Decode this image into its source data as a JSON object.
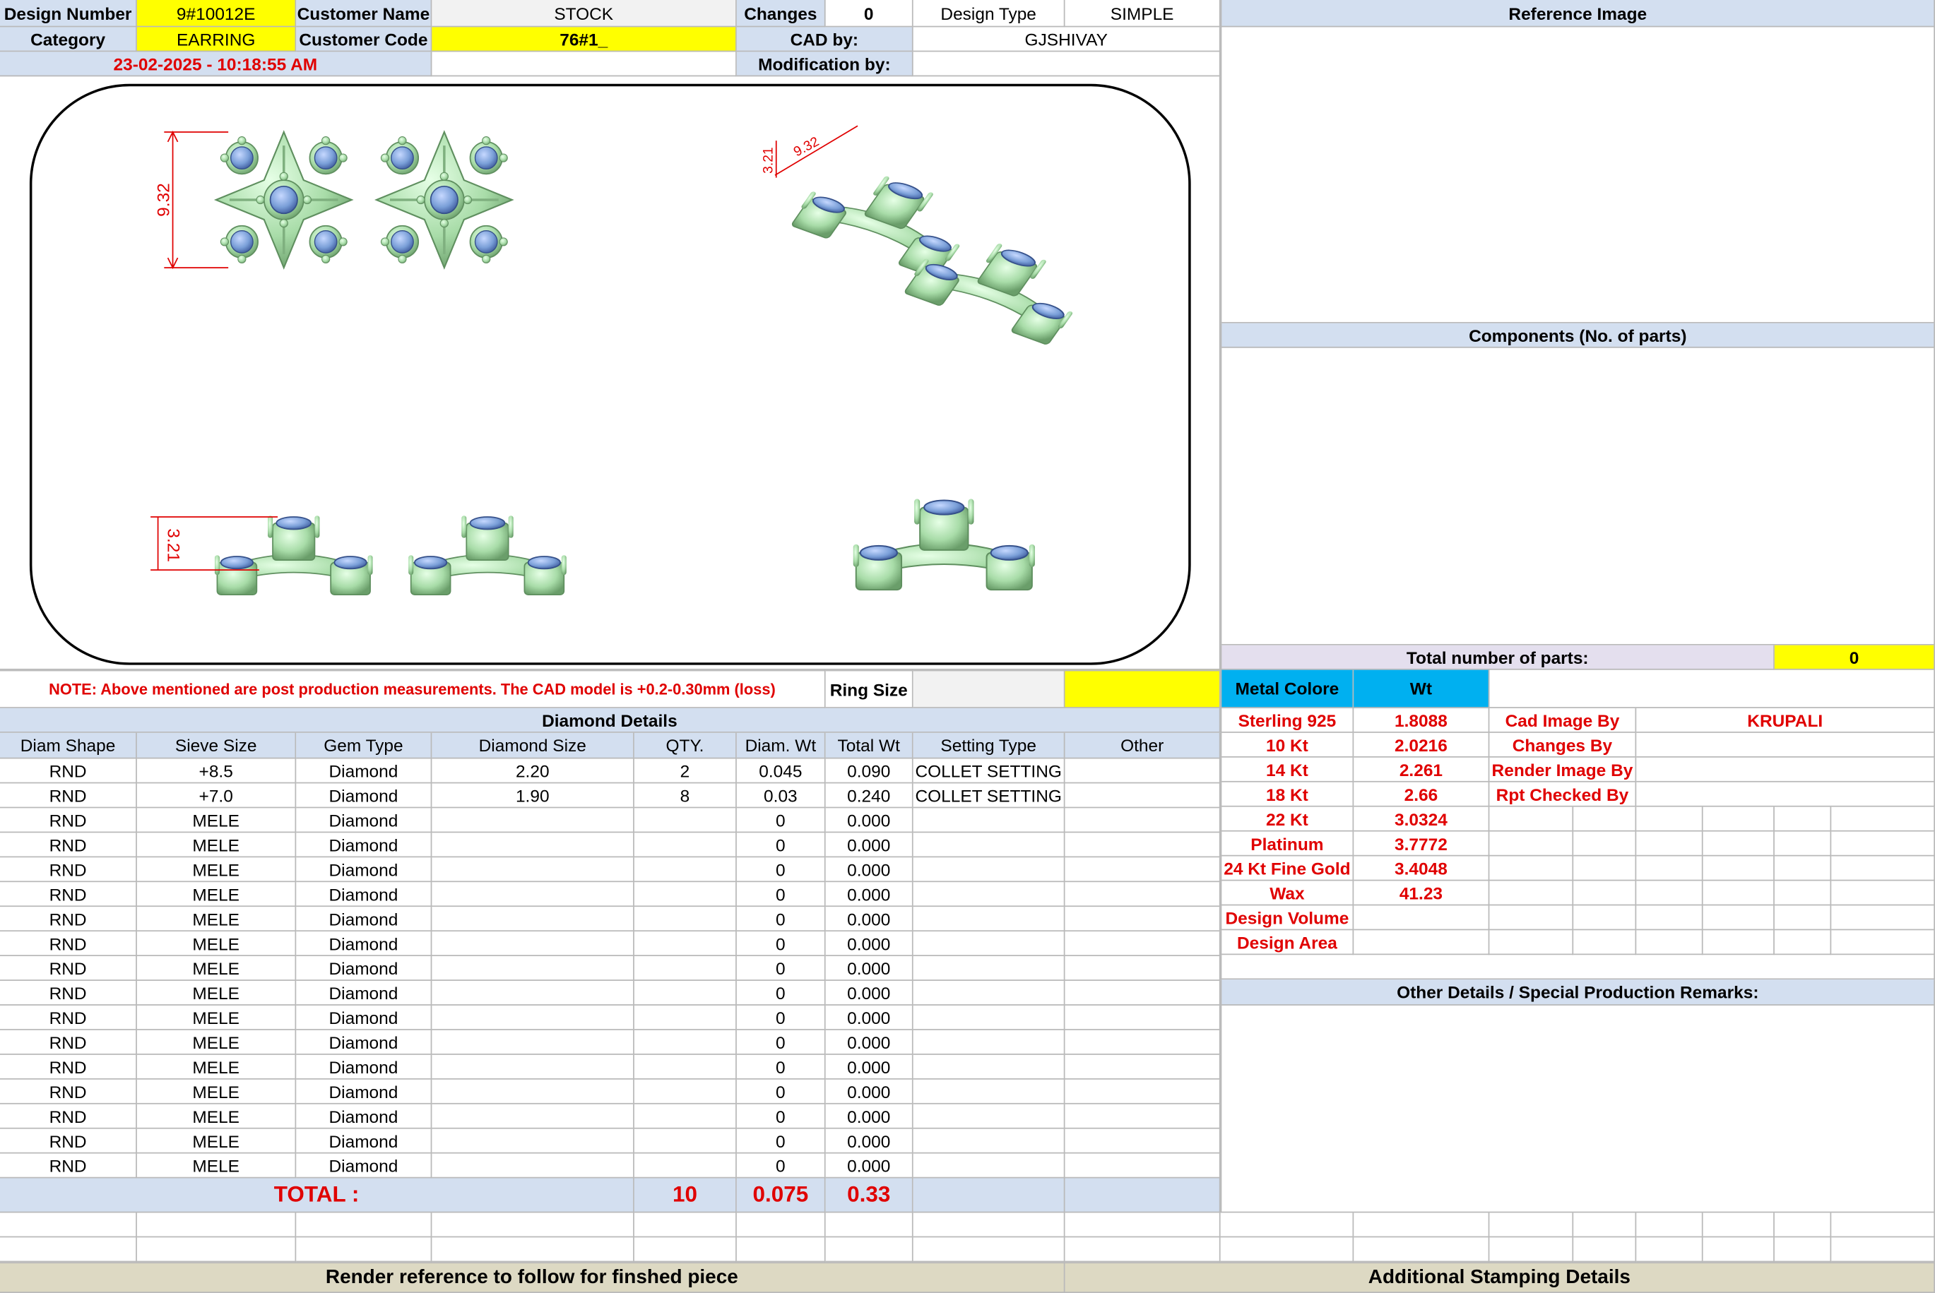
{
  "header": {
    "design_number_label": "Design Number",
    "design_number": "9#10012E",
    "customer_name_label": "Customer Name",
    "customer_name": "STOCK",
    "changes_label": "Changes",
    "changes": "0",
    "design_type_label": "Design Type",
    "design_type": "SIMPLE",
    "category_label": "Category",
    "category": "EARRING",
    "customer_code_label": "Customer Code",
    "customer_code": "76#1_",
    "cad_by_label": "CAD by:",
    "cad_by": "GJSHIVAY",
    "modification_by_label": "Modification by:",
    "timestamp": "23-02-2025 - 10:18:55 AM"
  },
  "right_panel": {
    "reference_image_label": "Reference Image",
    "components_label": "Components (No. of parts)",
    "total_parts_label": "Total number of parts:",
    "total_parts": "0"
  },
  "drawing": {
    "dim_height": "9.32",
    "dim_side": "3.21",
    "dim_iso_width": "9.32",
    "dim_iso_height": "3.21"
  },
  "note": "NOTE: Above mentioned are post production measurements. The CAD model is +0.2-0.30mm (loss)",
  "ring_size_label": "Ring Size",
  "diamond_details": {
    "title": "Diamond Details",
    "columns": [
      "Diam Shape",
      "Sieve Size",
      "Gem Type",
      "Diamond Size",
      "QTY.",
      "Diam. Wt",
      "Total Wt",
      "Setting Type",
      "Other"
    ],
    "rows": [
      [
        "RND",
        "+8.5",
        "Diamond",
        "2.20",
        "2",
        "0.045",
        "0.090",
        "COLLET SETTING",
        ""
      ],
      [
        "RND",
        "+7.0",
        "Diamond",
        "1.90",
        "8",
        "0.03",
        "0.240",
        "COLLET SETTING",
        ""
      ],
      [
        "RND",
        "MELE",
        "Diamond",
        "",
        "",
        "0",
        "0.000",
        "",
        ""
      ],
      [
        "RND",
        "MELE",
        "Diamond",
        "",
        "",
        "0",
        "0.000",
        "",
        ""
      ],
      [
        "RND",
        "MELE",
        "Diamond",
        "",
        "",
        "0",
        "0.000",
        "",
        ""
      ],
      [
        "RND",
        "MELE",
        "Diamond",
        "",
        "",
        "0",
        "0.000",
        "",
        ""
      ],
      [
        "RND",
        "MELE",
        "Diamond",
        "",
        "",
        "0",
        "0.000",
        "",
        ""
      ],
      [
        "RND",
        "MELE",
        "Diamond",
        "",
        "",
        "0",
        "0.000",
        "",
        ""
      ],
      [
        "RND",
        "MELE",
        "Diamond",
        "",
        "",
        "0",
        "0.000",
        "",
        ""
      ],
      [
        "RND",
        "MELE",
        "Diamond",
        "",
        "",
        "0",
        "0.000",
        "",
        ""
      ],
      [
        "RND",
        "MELE",
        "Diamond",
        "",
        "",
        "0",
        "0.000",
        "",
        ""
      ],
      [
        "RND",
        "MELE",
        "Diamond",
        "",
        "",
        "0",
        "0.000",
        "",
        ""
      ],
      [
        "RND",
        "MELE",
        "Diamond",
        "",
        "",
        "0",
        "0.000",
        "",
        ""
      ],
      [
        "RND",
        "MELE",
        "Diamond",
        "",
        "",
        "0",
        "0.000",
        "",
        ""
      ],
      [
        "RND",
        "MELE",
        "Diamond",
        "",
        "",
        "0",
        "0.000",
        "",
        ""
      ],
      [
        "RND",
        "MELE",
        "Diamond",
        "",
        "",
        "0",
        "0.000",
        "",
        ""
      ],
      [
        "RND",
        "MELE",
        "Diamond",
        "",
        "",
        "0",
        "0.000",
        "",
        ""
      ]
    ],
    "total_label": "TOTAL :",
    "total_qty": "10",
    "total_diam_wt": "0.075",
    "total_wt": "0.33"
  },
  "metal": {
    "header_label": "Metal Colore",
    "header_wt": "Wt",
    "rows": [
      {
        "label": "Sterling 925",
        "wt": "1.8088"
      },
      {
        "label": "10 Kt",
        "wt": "2.0216"
      },
      {
        "label": "14 Kt",
        "wt": "2.261"
      },
      {
        "label": "18 Kt",
        "wt": "2.66"
      },
      {
        "label": "22 Kt",
        "wt": "3.0324"
      },
      {
        "label": "Platinum",
        "wt": "3.7772"
      },
      {
        "label": "24 Kt Fine Gold",
        "wt": "3.4048"
      },
      {
        "label": "Wax",
        "wt": "41.23"
      },
      {
        "label": "Design Volume",
        "wt": ""
      },
      {
        "label": "Design Area",
        "wt": ""
      }
    ]
  },
  "staff": {
    "cad_image_by_label": "Cad Image By",
    "cad_image_by": "KRUPALI",
    "changes_by_label": "Changes By",
    "render_image_by_label": "Render Image By",
    "rpt_checked_by_label": "Rpt Checked By"
  },
  "other_details_label": "Other Details / Special Production Remarks:",
  "footer": {
    "render_reference": "Render reference to follow for finshed piece",
    "stamping": "Additional Stamping Details"
  },
  "colors": {
    "header_blue": "#d3dff0",
    "highlight_yellow": "#ffff00",
    "metal_header": "#00b0f0",
    "label_red": "#e00000",
    "footer_tan": "#ddd9c3",
    "metal_green": "#b4e6b4",
    "stone_blue": "#7a9fd8"
  }
}
